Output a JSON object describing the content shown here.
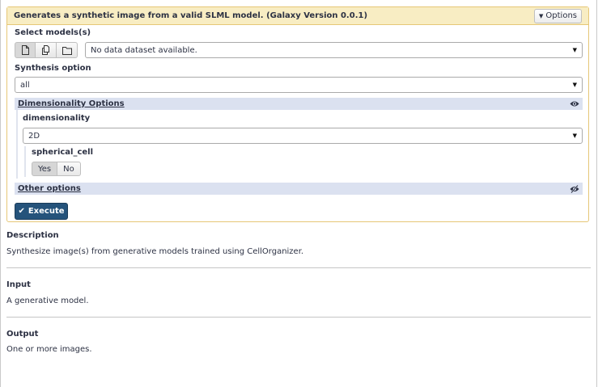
{
  "tool": {
    "title": "Generates a synthetic image from a valid SLML model. (Galaxy Version 0.0.1)",
    "options_label": "Options"
  },
  "form": {
    "models_label": "Select models(s)",
    "models_value": "No data dataset available.",
    "synthesis_label": "Synthesis option",
    "synthesis_value": "all",
    "dimensionality_section": "Dimensionality Options",
    "dimensionality_label": "dimensionality",
    "dimensionality_value": "2D",
    "spherical_label": "spherical_cell",
    "yes_label": "Yes",
    "no_label": "No",
    "spherical_value": "Yes",
    "other_section": "Other options",
    "execute_label": "Execute"
  },
  "help": {
    "description_title": "Description",
    "description_text": "Synthesize image(s) from generative models trained using CellOrganizer.",
    "input_title": "Input",
    "input_text": "A generative model.",
    "output_title": "Output",
    "output_text": "One or more images."
  },
  "colors": {
    "header_bg": "#f8edc3",
    "panel_border": "#e6c777",
    "section_bg": "#dbe1f0",
    "execute_bg": "#25537b"
  }
}
